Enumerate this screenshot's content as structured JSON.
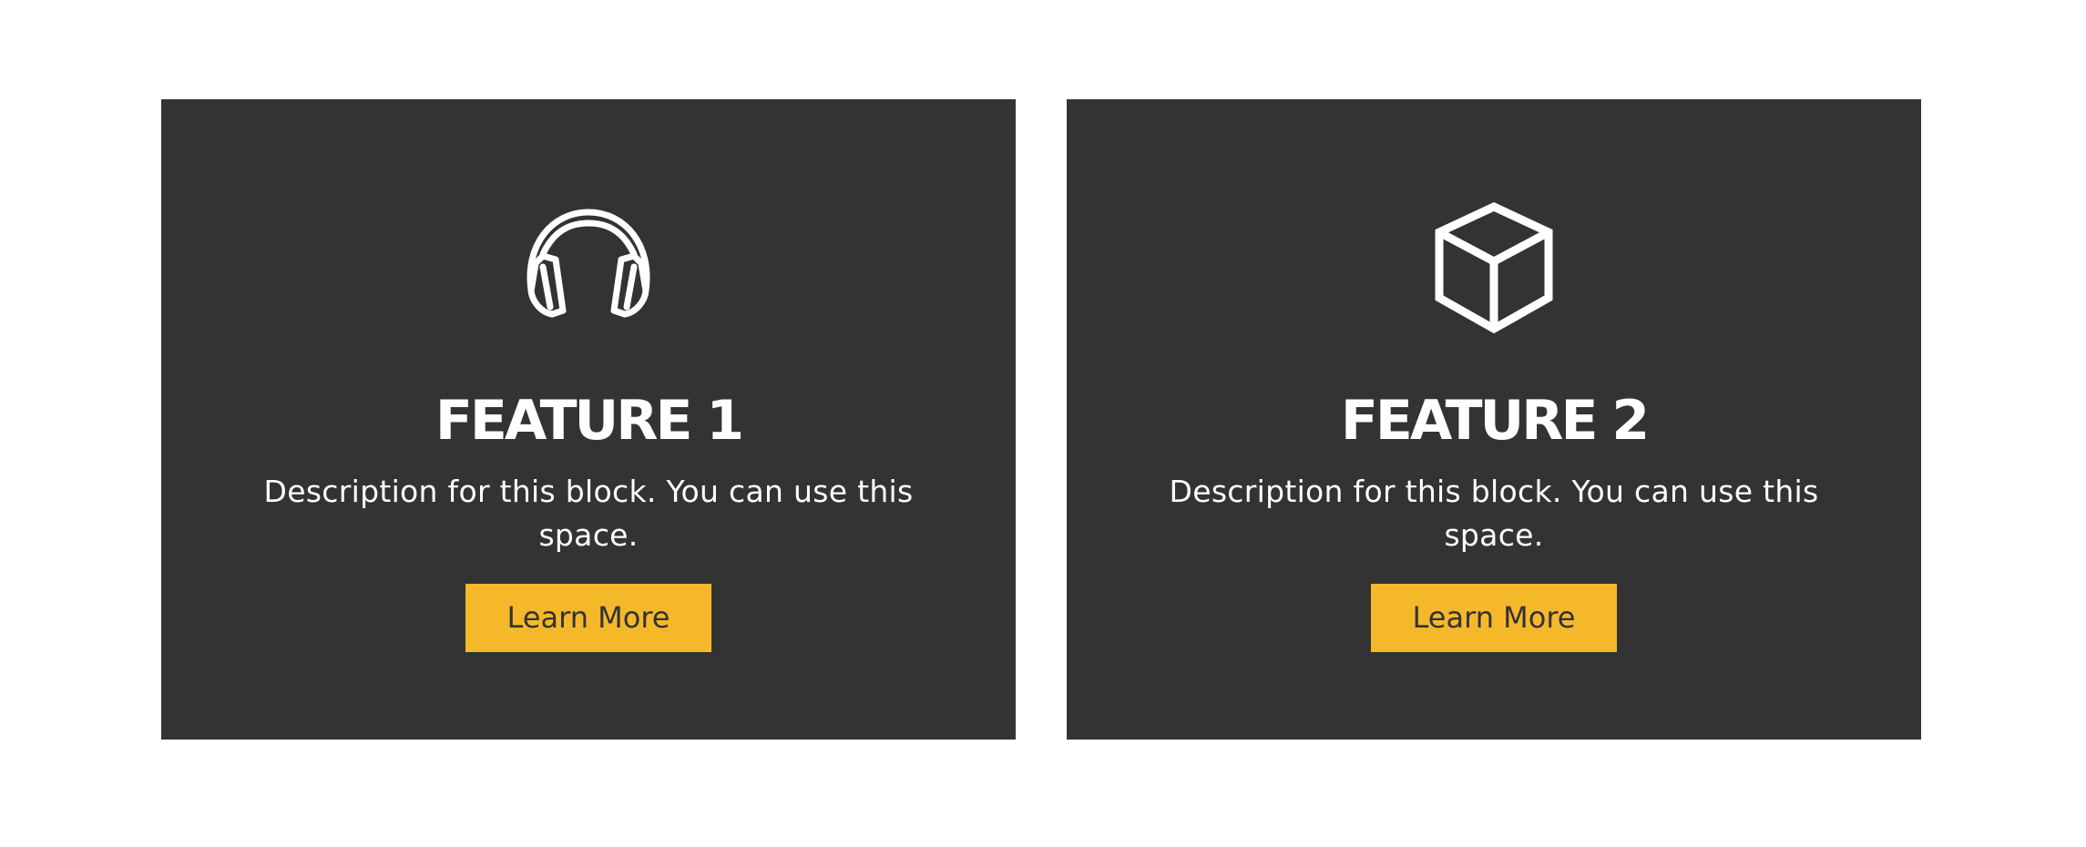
{
  "colors": {
    "page_background": "#ffffff",
    "card_background": "#333333",
    "text_light": "#ffffff",
    "button_background": "#f5b82b",
    "button_text": "#333333"
  },
  "features": [
    {
      "icon": "headphones-icon",
      "title": "FEATURE 1",
      "description": "Description for this block. You can use this space.",
      "button_label": "Learn More"
    },
    {
      "icon": "cube-icon",
      "title": "FEATURE 2",
      "description": "Description for this block. You can use this space.",
      "button_label": "Learn More"
    }
  ]
}
